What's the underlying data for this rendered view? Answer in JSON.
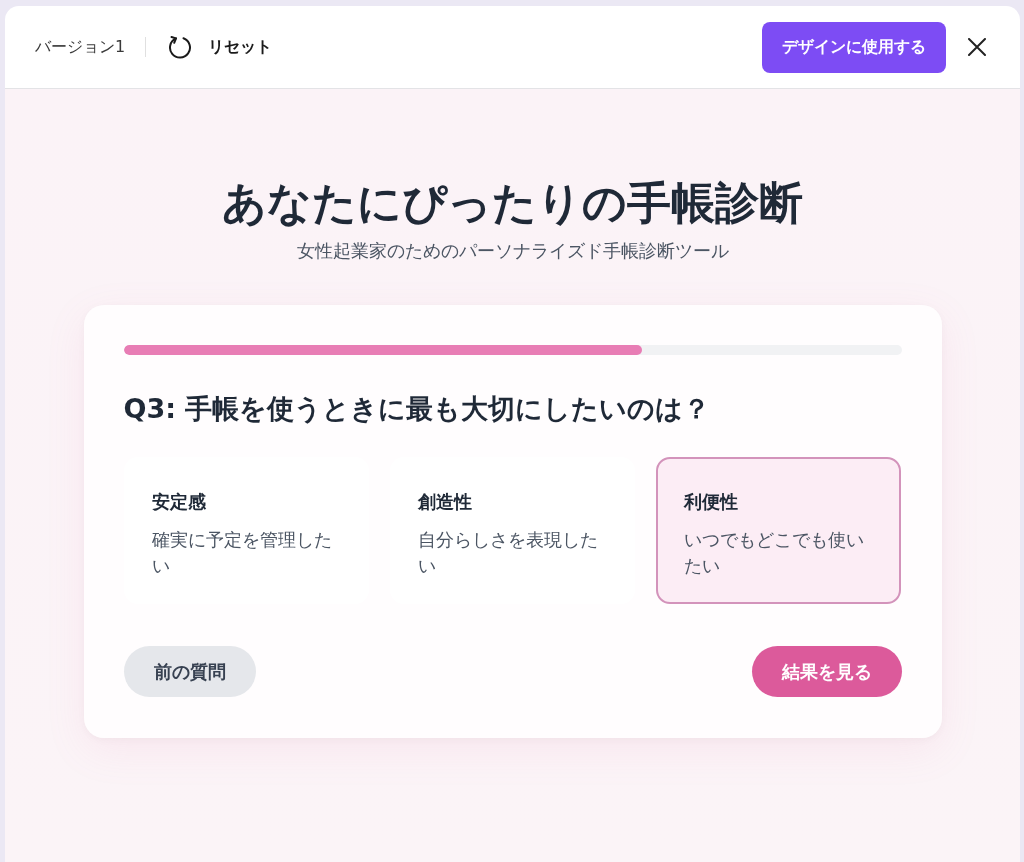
{
  "header": {
    "version_label": "バージョン1",
    "reset_label": "リセット",
    "use_button": "デザインに使用する"
  },
  "quiz": {
    "title": "あなたにぴったりの手帳診断",
    "subtitle": "女性起業家のためのパーソナライズド手帳診断ツール",
    "progress": {
      "level": 0.667
    },
    "question": "Q3: 手帳を使うときに最も大切にしたいのは？",
    "options": [
      {
        "title": "安定感",
        "description": "確実に予定を管理したい",
        "selected": false
      },
      {
        "title": "創造性",
        "description": "自分らしさを表現したい",
        "selected": false
      },
      {
        "title": "利便性",
        "description": "いつでもどこでも使いたい",
        "selected": true
      }
    ],
    "back_button": "前の質問",
    "next_button": "結果を見る"
  }
}
